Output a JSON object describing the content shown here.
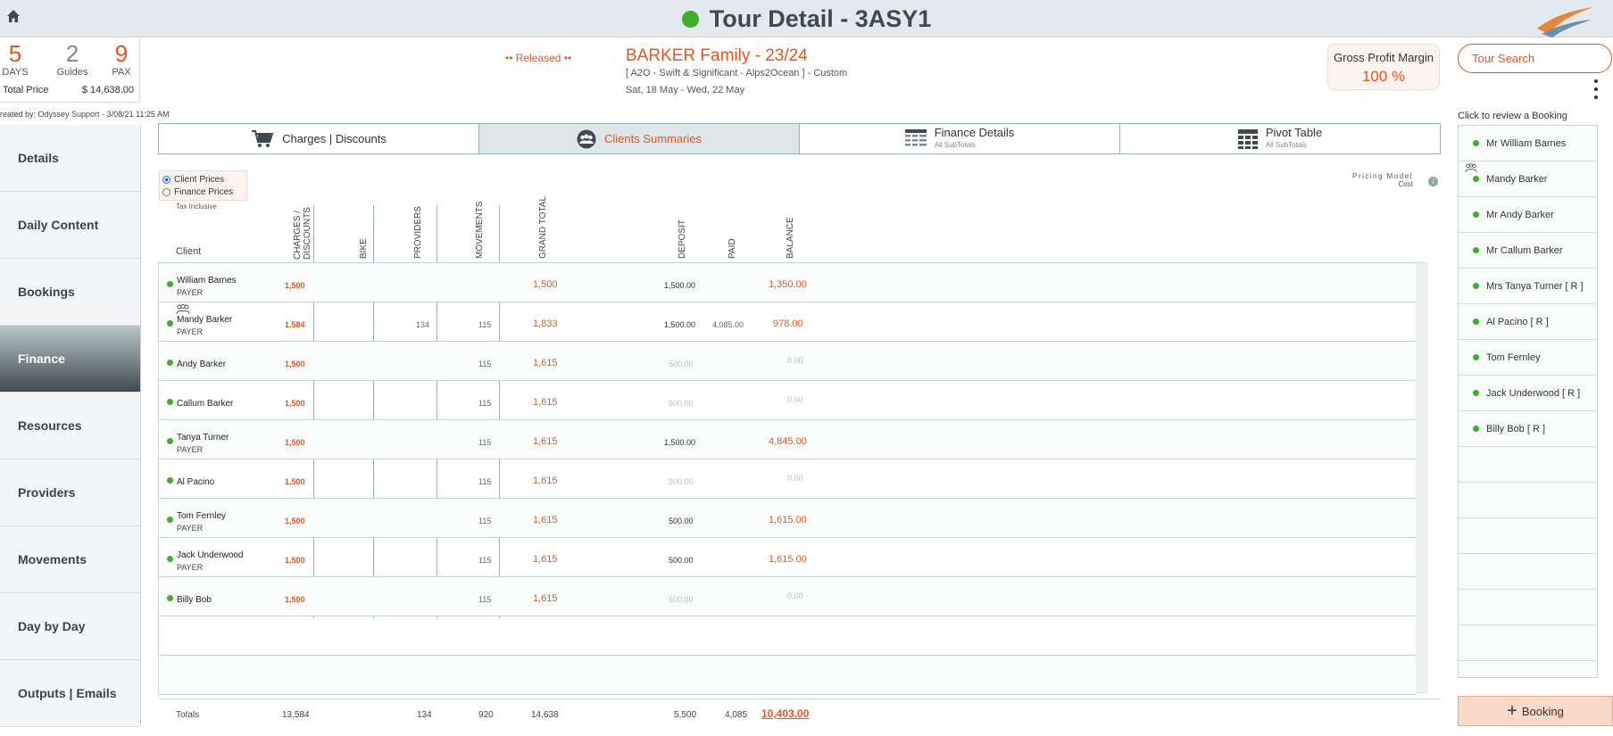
{
  "header": {
    "title": "Tour Detail - 3ASY1",
    "status_color": "#3fae2a",
    "accent_color": "#e8541c"
  },
  "stats": {
    "days": "5",
    "days_label": "DAYS",
    "guides": "2",
    "guides_label": "Guides",
    "pax": "9",
    "pax_label": "PAX",
    "total_price_label": "Total Price",
    "total_price": "$ 14,638.00",
    "created_by": "reated by: Odyssey Support - 3/08/21 11:25 AM"
  },
  "tour": {
    "status": "•• Released ••",
    "name": "BARKER Family - 23/24",
    "subtitle": "[ A2O - Swift & Significant - Alps2Ocean ] - Custom",
    "dates": "Sat, 18 May  - Wed, 22 May"
  },
  "gpm": {
    "label": "Gross Profit Margin",
    "value": "100 %"
  },
  "search": {
    "placeholder": "Tour Search"
  },
  "nav": [
    {
      "label": "Details"
    },
    {
      "label": "Daily Content"
    },
    {
      "label": "Bookings"
    },
    {
      "label": "Finance"
    },
    {
      "label": "Resources"
    },
    {
      "label": "Providers"
    },
    {
      "label": "Movements"
    },
    {
      "label": "Day by Day"
    },
    {
      "label": "Outputs | Emails"
    }
  ],
  "tabs": [
    {
      "label": "Charges | Discounts",
      "sub": ""
    },
    {
      "label": "Clients Summaries",
      "sub": ""
    },
    {
      "label": "Finance Details",
      "sub": "All SubTotals"
    },
    {
      "label": "Pivot Table",
      "sub": "All SubTotals"
    }
  ],
  "price_mode": {
    "client": "Client Prices",
    "finance": "Finance Prices",
    "tax": "Tax Inclusive"
  },
  "pricing_model": {
    "label": "Pricing Model",
    "value": "Cost"
  },
  "columns": {
    "client": "Client",
    "charges": "CHARGES / DISCOUNTS",
    "bike": "BIKE",
    "providers": "PROVIDERS",
    "movements": "MOVEMENTS",
    "grand_total": "GRAND TOTAL",
    "deposit": "DEPOSIT",
    "paid": "PAID",
    "balance": "BALANCE"
  },
  "rows": [
    {
      "name": "William Barnes",
      "role": "PAYER",
      "charges": "1,500",
      "providers": "",
      "movements": "",
      "grand": "1,500",
      "deposit": "1,500.00",
      "paid": "",
      "balance": "1,350.00",
      "muted": false
    },
    {
      "name": "Mandy Barker",
      "role": "PAYER",
      "charges": "1,584",
      "providers": "134",
      "movements": "115",
      "grand": "1,833",
      "deposit": "1,500.00",
      "paid": "4,085.00",
      "balance": "978.00",
      "muted": false
    },
    {
      "name": "Andy Barker",
      "role": "",
      "charges": "1,500",
      "providers": "",
      "movements": "115",
      "grand": "1,615",
      "deposit": "500.00",
      "paid": "",
      "balance": "0.00",
      "muted": true
    },
    {
      "name": "Callum Barker",
      "role": "",
      "charges": "1,500",
      "providers": "",
      "movements": "115",
      "grand": "1,615",
      "deposit": "500.00",
      "paid": "",
      "balance": "0.00",
      "muted": true
    },
    {
      "name": "Tanya Turner",
      "role": "PAYER",
      "charges": "1,500",
      "providers": "",
      "movements": "115",
      "grand": "1,615",
      "deposit": "1,500.00",
      "paid": "",
      "balance": "4,845.00",
      "muted": false
    },
    {
      "name": "Al Pacino",
      "role": "",
      "charges": "1,500",
      "providers": "",
      "movements": "115",
      "grand": "1,615",
      "deposit": "500.00",
      "paid": "",
      "balance": "0.00",
      "muted": true
    },
    {
      "name": "Tom Fernley",
      "role": "PAYER",
      "charges": "1,500",
      "providers": "",
      "movements": "115",
      "grand": "1,615",
      "deposit": "500.00",
      "paid": "",
      "balance": "1,615.00",
      "muted": false
    },
    {
      "name": "Jack Underwood",
      "role": "PAYER",
      "charges": "1,500",
      "providers": "",
      "movements": "115",
      "grand": "1,615",
      "deposit": "500.00",
      "paid": "",
      "balance": "1,615.00",
      "muted": false
    },
    {
      "name": "Billy Bob",
      "role": "",
      "charges": "1,500",
      "providers": "",
      "movements": "115",
      "grand": "1,615",
      "deposit": "500.00",
      "paid": "",
      "balance": "0.00",
      "muted": true
    }
  ],
  "totals": {
    "label": "Totals",
    "charges": "13,584",
    "providers": "134",
    "movements": "920",
    "grand": "14,638",
    "deposit": "5,500",
    "paid": "4,085",
    "balance": "10,403.00"
  },
  "bookings": {
    "label": "Click to review a Booking",
    "items": [
      "Mr William Barnes",
      "Mandy Barker",
      "Mr Andy Barker",
      "Mr Callum Barker",
      "Mrs Tanya Turner  [ R ]",
      "Al Pacino  [ R ]",
      "Tom Fernley",
      "Jack Underwood  [ R ]",
      "Billy Bob  [ R ]"
    ],
    "add_label": "Booking"
  }
}
